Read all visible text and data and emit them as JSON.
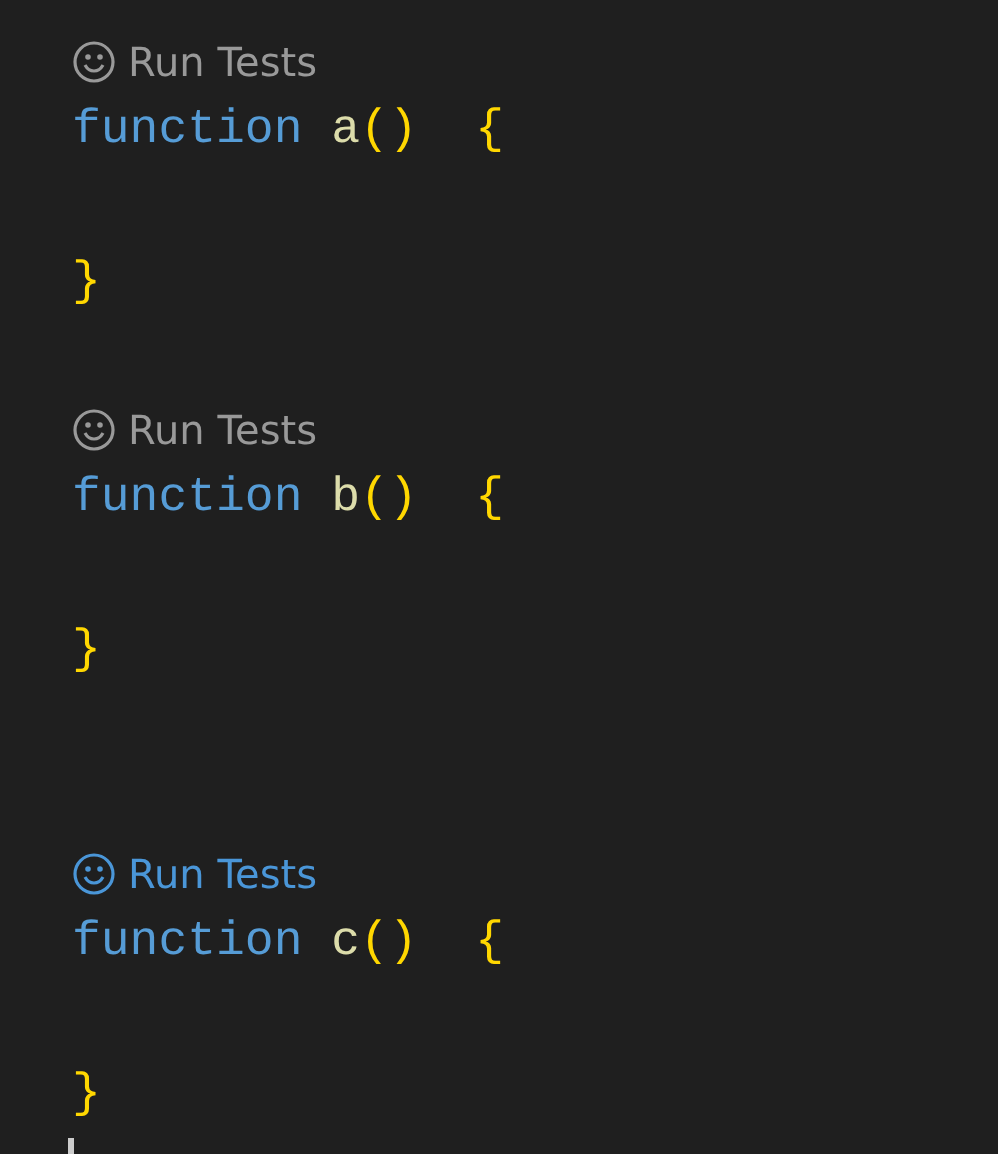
{
  "lines": [
    {
      "kind": "lens",
      "label": "Run Tests",
      "hovered": false
    },
    {
      "kind": "code",
      "tokens": [
        {
          "kind": "keyword",
          "text": "function"
        },
        {
          "kind": "name",
          "text": "a"
        },
        {
          "kind": "bracket",
          "text": "()"
        },
        {
          "kind": "brace",
          "text": "{"
        }
      ]
    },
    {
      "kind": "blank"
    },
    {
      "kind": "code",
      "tokens": [
        {
          "kind": "brace",
          "text": "}"
        }
      ]
    },
    {
      "kind": "blank"
    },
    {
      "kind": "lens",
      "label": "Run Tests",
      "hovered": false
    },
    {
      "kind": "code",
      "tokens": [
        {
          "kind": "keyword",
          "text": "function"
        },
        {
          "kind": "name",
          "text": "b"
        },
        {
          "kind": "bracket",
          "text": "()"
        },
        {
          "kind": "brace",
          "text": "{"
        }
      ]
    },
    {
      "kind": "blank"
    },
    {
      "kind": "code",
      "tokens": [
        {
          "kind": "brace",
          "text": "}"
        }
      ]
    },
    {
      "kind": "blank"
    },
    {
      "kind": "blank"
    },
    {
      "kind": "lens",
      "label": "Run Tests",
      "hovered": true
    },
    {
      "kind": "code",
      "tokens": [
        {
          "kind": "keyword",
          "text": "function"
        },
        {
          "kind": "name",
          "text": "c"
        },
        {
          "kind": "bracket",
          "text": "()"
        },
        {
          "kind": "brace",
          "text": "{"
        }
      ]
    },
    {
      "kind": "blank"
    },
    {
      "kind": "code",
      "tokens": [
        {
          "kind": "brace",
          "text": "}"
        }
      ]
    }
  ]
}
